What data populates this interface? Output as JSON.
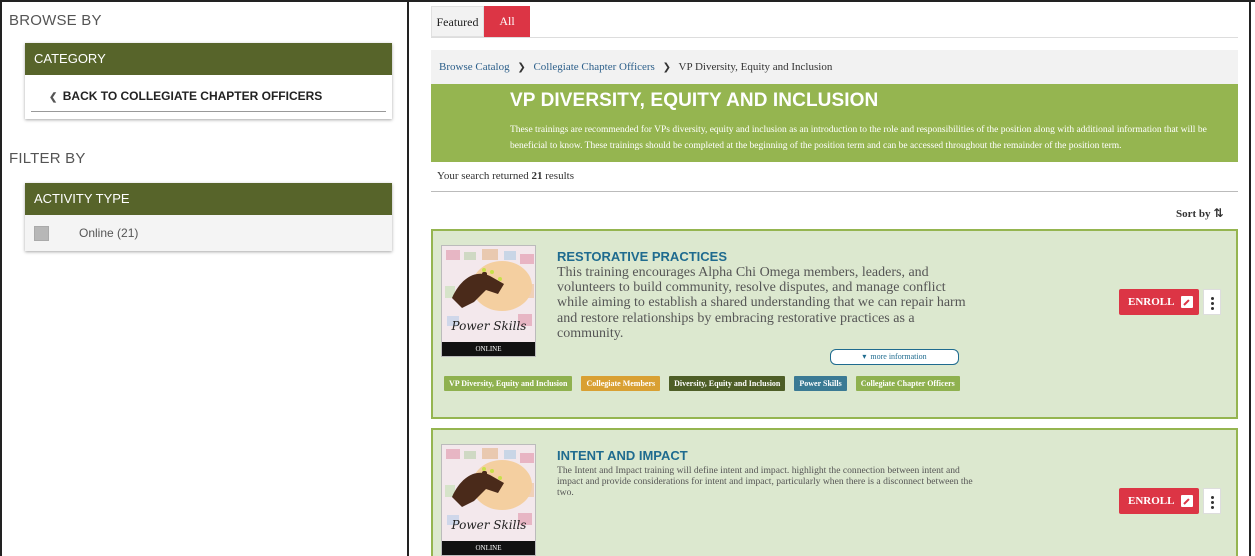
{
  "sidebar": {
    "browse_heading": "BROWSE BY",
    "category_header": "CATEGORY",
    "back_link": "BACK TO COLLEGIATE CHAPTER OFFICERS",
    "filter_heading": "FILTER BY",
    "activity_header": "ACTIVITY TYPE",
    "filters": [
      {
        "label": "Online (21)",
        "checked": false
      }
    ]
  },
  "tabs": [
    {
      "label": "Featured",
      "active": false
    },
    {
      "label": "All",
      "active": true
    }
  ],
  "breadcrumb": {
    "items": [
      "Browse Catalog",
      "Collegiate Chapter Officers",
      "VP Diversity, Equity and Inclusion"
    ]
  },
  "banner": {
    "title": "VP DIVERSITY, EQUITY AND INCLUSION",
    "description": "These trainings are recommended for VPs diversity, equity and inclusion as an introduction to the role and responsibilities of the position along with additional information that will be beneficial to know. These trainings should be completed at the beginning of the position term and can be accessed throughout the remainder of the position term."
  },
  "results": {
    "prefix": "Your search returned ",
    "count": "21",
    "suffix": " results"
  },
  "sort": {
    "label": "Sort by"
  },
  "cards": [
    {
      "title": "RESTORATIVE PRACTICES",
      "description": "This training encourages Alpha Chi Omega members, leaders, and volunteers to build community, resolve disputes, and manage conflict while aiming to establish a shared understanding that we can repair harm and restore relationships by embracing restorative practices as a community.",
      "thumb_text": "Power Skills",
      "thumb_label": "ONLINE",
      "more_info": "more information",
      "enroll": "ENROLL",
      "tags": [
        {
          "label": "VP Diversity, Equity and Inclusion",
          "color": "#8fb14f"
        },
        {
          "label": "Collegiate Members",
          "color": "#d9a033"
        },
        {
          "label": "Diversity, Equity and Inclusion",
          "color": "#4e5e27"
        },
        {
          "label": "Power Skills",
          "color": "#3b7a94"
        },
        {
          "label": "Collegiate Chapter Officers",
          "color": "#8fb14f"
        }
      ]
    },
    {
      "title": "INTENT AND IMPACT",
      "description": "The Intent and Impact training will define intent and impact. highlight the connection between intent and impact and provide considerations for intent and impact, particularly when there is a disconnect between the two.",
      "thumb_text": "Power Skills",
      "thumb_label": "ONLINE",
      "enroll": "ENROLL"
    }
  ],
  "colors": {
    "header_green": "#57642a",
    "banner_green": "#95b550",
    "card_bg": "#dce8cf",
    "accent_red": "#dc3545",
    "title_blue": "#1f6b8f"
  },
  "icons": [
    "chevron-left-icon",
    "breadcrumb-chevron-icon",
    "sort-icon",
    "edit-icon",
    "kebab-menu-icon",
    "caret-down-icon"
  ]
}
